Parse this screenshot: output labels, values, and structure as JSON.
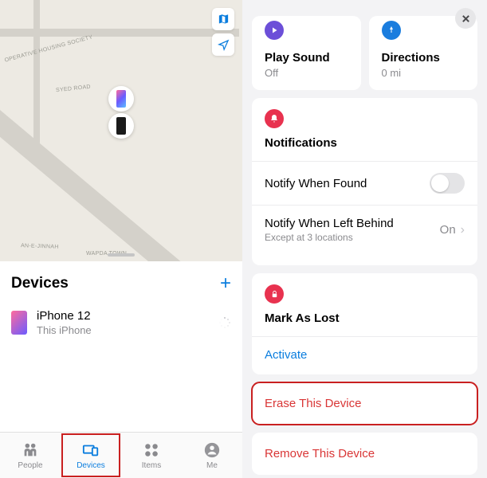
{
  "map": {
    "labels": [
      "OPERATIVE HOUSING SOCIETY",
      "SYED ROAD",
      "AN-E-JINNAH",
      "WAPDA TOWN"
    ]
  },
  "devices_panel": {
    "title": "Devices",
    "device": {
      "name": "iPhone 12",
      "subtitle": "This iPhone"
    }
  },
  "tabs": [
    {
      "id": "people",
      "label": "People"
    },
    {
      "id": "devices",
      "label": "Devices"
    },
    {
      "id": "items",
      "label": "Items"
    },
    {
      "id": "me",
      "label": "Me"
    }
  ],
  "actions": {
    "play_sound": {
      "title": "Play Sound",
      "status": "Off"
    },
    "directions": {
      "title": "Directions",
      "status": "0 mi"
    }
  },
  "notifications": {
    "heading": "Notifications",
    "notify_found": {
      "title": "Notify When Found"
    },
    "notify_left": {
      "title": "Notify When Left Behind",
      "subtitle": "Except at 3 locations",
      "value": "On"
    }
  },
  "mark_lost": {
    "heading": "Mark As Lost",
    "activate": "Activate"
  },
  "erase": {
    "label": "Erase This Device"
  },
  "remove": {
    "label": "Remove This Device"
  }
}
